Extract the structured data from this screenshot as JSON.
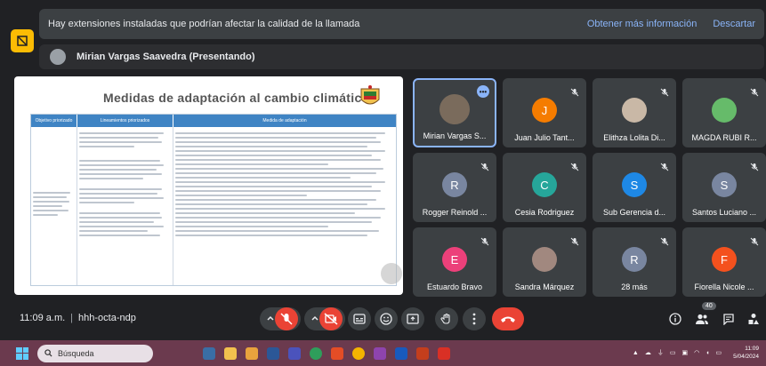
{
  "banner": {
    "message": "Hay extensiones instaladas que podrían afectar la calidad de la llamada",
    "link_more": "Obtener más información",
    "link_dismiss": "Descartar"
  },
  "presenter": {
    "label": "Mirian Vargas Saavedra (Presentando)"
  },
  "slide": {
    "title": "Medidas de adaptación al cambio climático",
    "col1_header": "Objetivo priorizado",
    "col2_header": "Lineamientos priorizados",
    "col3_header": "Medida de adaptación"
  },
  "tiles": [
    {
      "name": "Mirian Vargas S...",
      "initial": "",
      "color": "#7a6b5c",
      "active": true,
      "more": true
    },
    {
      "name": "Juan Julio Tant...",
      "initial": "J",
      "color": "#f57c00",
      "active": false
    },
    {
      "name": "Elithza Lolita Di...",
      "initial": "",
      "color": "#c9b8a6",
      "active": false
    },
    {
      "name": "MAGDA RUBI R...",
      "initial": "",
      "color": "#66bb6a",
      "active": false
    },
    {
      "name": "Rogger Reinold ...",
      "initial": "R",
      "color": "#7986a0",
      "active": false
    },
    {
      "name": "Cesia Rodriguez",
      "initial": "C",
      "color": "#26a69a",
      "active": false
    },
    {
      "name": "Sub Gerencia d...",
      "initial": "S",
      "color": "#1e88e5",
      "active": false
    },
    {
      "name": "Santos Luciano ...",
      "initial": "S",
      "color": "#7986a0",
      "active": false
    },
    {
      "name": "Estuardo Bravo",
      "initial": "E",
      "color": "#ec407a",
      "active": false
    },
    {
      "name": "Sandra Márquez",
      "initial": "",
      "color": "#a1887f",
      "active": false
    },
    {
      "name": "28 más",
      "initial": "R",
      "color": "#7986a0",
      "active": false
    },
    {
      "name": "Fiorella Nicole ...",
      "initial": "F",
      "color": "#f4511e",
      "active": false
    }
  ],
  "meeting": {
    "time": "11:09 a.m.",
    "separator": "|",
    "code": "hhh-octa-ndp",
    "participants_badge": "40"
  },
  "taskbar": {
    "search_label": "Búsqueda",
    "clock_time": "11:09",
    "clock_date": "5/04/2024"
  },
  "colors": {
    "accent": "#8ab4f8",
    "end_call": "#ea4335",
    "banner_bg": "#3c4043",
    "taskbar": "#6b3a4e"
  }
}
